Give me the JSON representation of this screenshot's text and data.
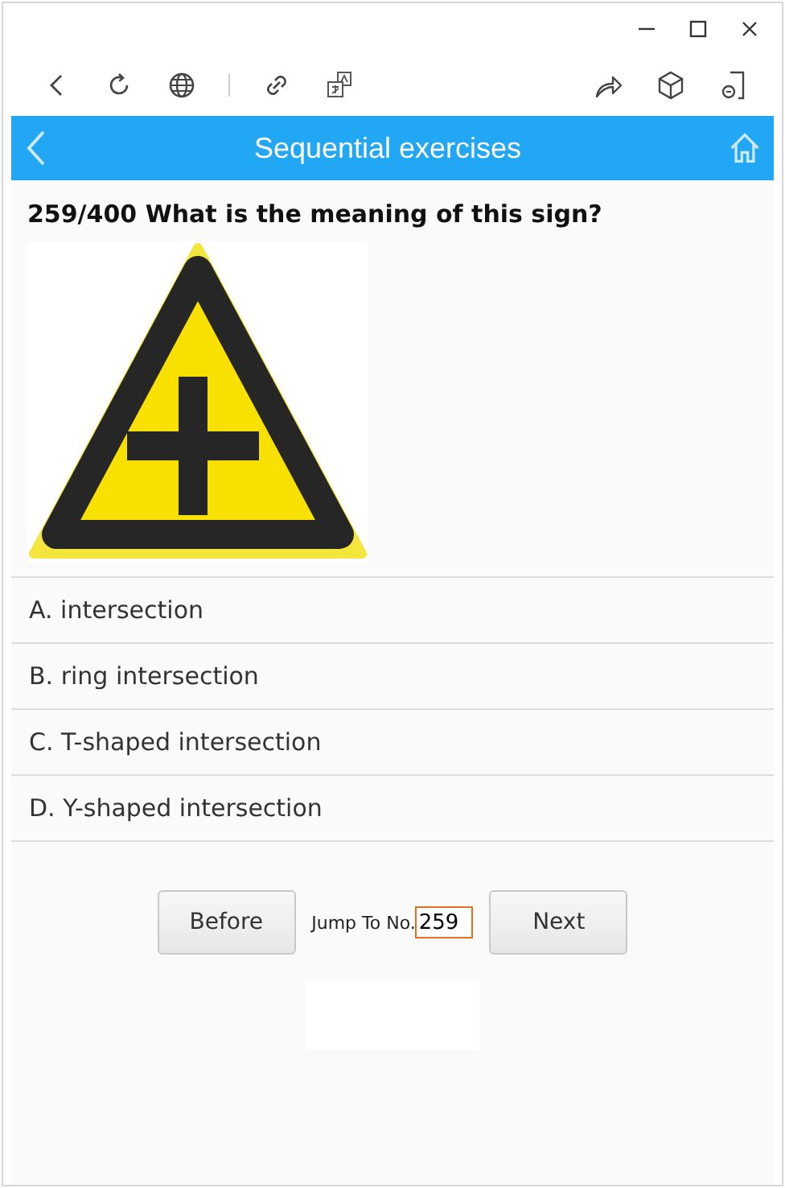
{
  "header": {
    "title": "Sequential exercises"
  },
  "question": {
    "text": "259/400 What is the meaning of this sign?"
  },
  "options": [
    {
      "text": "A. intersection"
    },
    {
      "text": "B. ring intersection"
    },
    {
      "text": "C. T-shaped intersection"
    },
    {
      "text": "D. Y-shaped intersection"
    }
  ],
  "navigation": {
    "previous": "Before",
    "jump_label": "Jump To No.",
    "jump_value": "259",
    "next": "Next"
  }
}
